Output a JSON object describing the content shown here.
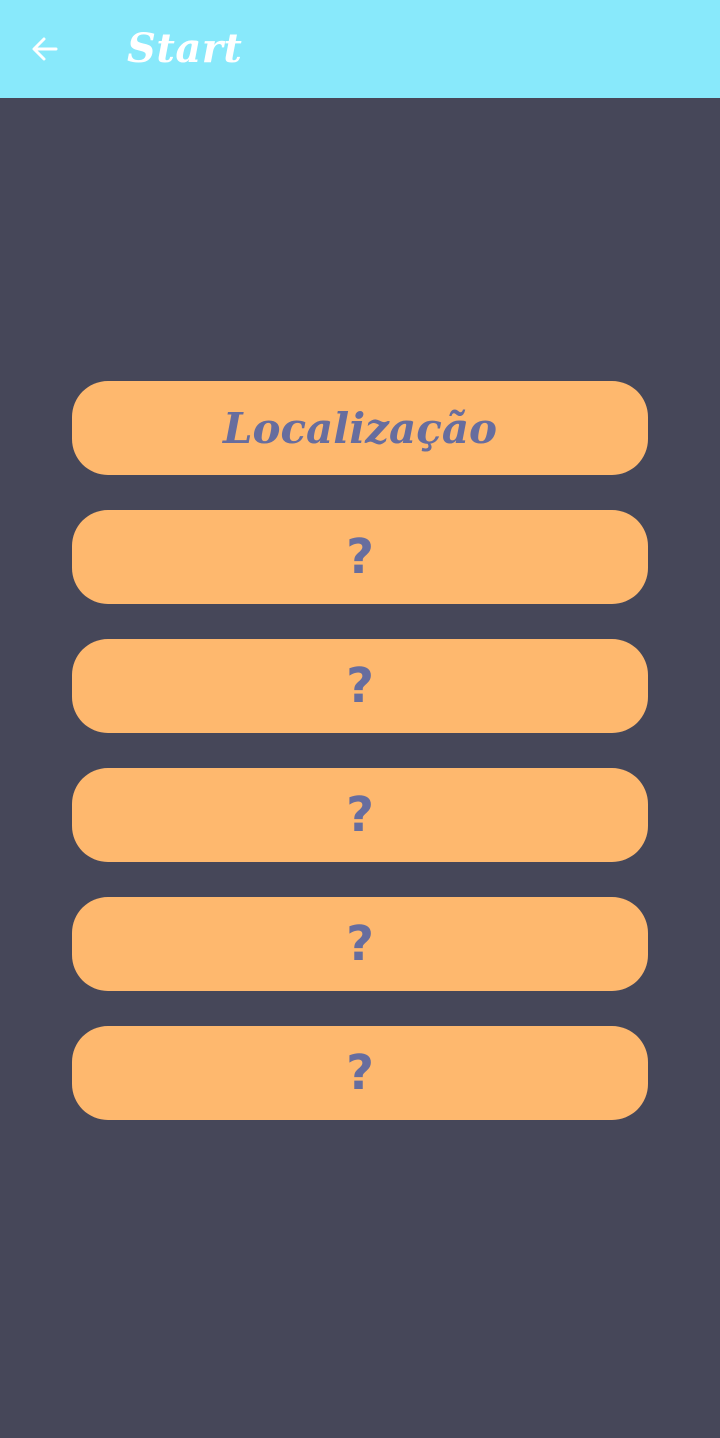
{
  "appbar": {
    "title": "Start",
    "back_icon": "arrow-left-icon",
    "background": "#88E9FB"
  },
  "page": {
    "background": "#464759"
  },
  "menu": {
    "button_color": "#FEB86E",
    "text_color": "#676D9E",
    "items": [
      {
        "label": "Localização"
      },
      {
        "label": "?"
      },
      {
        "label": "?"
      },
      {
        "label": "?"
      },
      {
        "label": "?"
      },
      {
        "label": "?"
      }
    ]
  }
}
